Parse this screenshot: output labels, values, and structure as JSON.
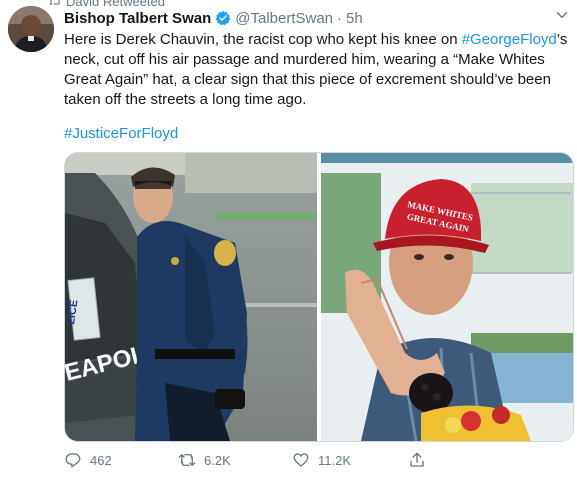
{
  "retweet": {
    "label": "David Retweeted"
  },
  "author": {
    "name": "Bishop Talbert Swan",
    "handle": "@TalbertSwan",
    "separator": "·",
    "time": "5h"
  },
  "tweet": {
    "text_1": "Here is Derek Chauvin, the racist cop who kept his knee on ",
    "hashtag_1": "#GeorgeFloyd",
    "text_2": "’s neck, cut off his air passage and murdered him, wearing a “Make Whites Great Again” hat, a clear sign that this piece of excrement should’ve been taken off the streets a long time ago.",
    "hashtag_2": "#JusticeForFloyd"
  },
  "media": {
    "left_photo": {
      "car_lettering": "EAPOLIS",
      "plate_lettering": "LICE"
    },
    "right_photo": {
      "hat_lettering": [
        "MAKE WHITES",
        "GREAT AGAIN"
      ]
    }
  },
  "actions": {
    "reply_count": "462",
    "retweet_count": "6.2K",
    "like_count": "11.2K"
  },
  "colors": {
    "link": "#1b95e0",
    "secondary_text": "#657786",
    "verified": "#1da1f2"
  },
  "icons": [
    "retweet-icon",
    "verified-badge-icon",
    "caret-down-icon",
    "reply-icon",
    "retweet-action-icon",
    "like-icon",
    "share-icon"
  ]
}
